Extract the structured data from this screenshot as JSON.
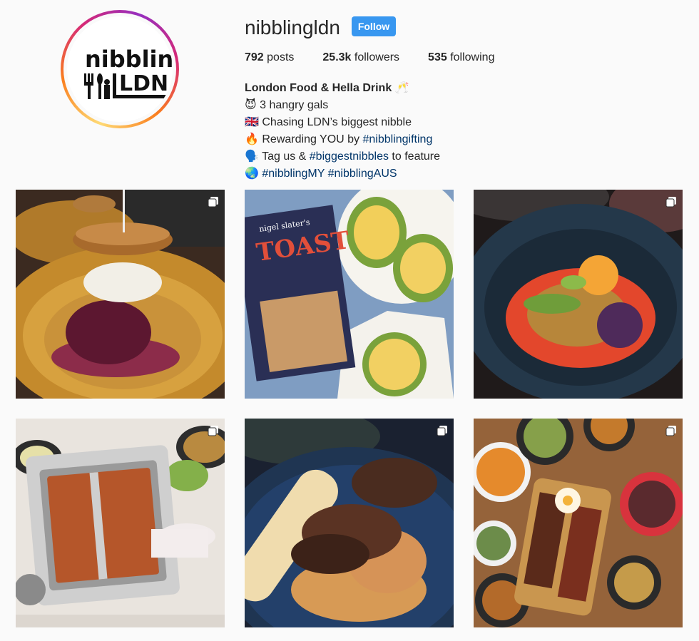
{
  "profile": {
    "username": "nibblingldn",
    "follow_label": "Follow",
    "logo": {
      "top": "nibbling",
      "bottom": "LDN"
    },
    "stats": {
      "posts_count": "792",
      "posts_label": "posts",
      "followers_count": "25.3k",
      "followers_label": "followers",
      "following_count": "535",
      "following_label": "following"
    },
    "bio": {
      "name": "London Food & Hella Drink",
      "name_emoji": "🥂",
      "lines": [
        {
          "emoji": "😈",
          "text": "3 hangry gals",
          "tag": ""
        },
        {
          "emoji": "🇬🇧",
          "text": "Chasing LDN’s biggest nibble",
          "tag": ""
        },
        {
          "emoji": "🔥",
          "text": "Rewarding YOU by ",
          "tag": "#nibblingifting"
        },
        {
          "emoji": "🗣️",
          "text": "Tag us & ",
          "tag": "#biggestnibbles",
          "after": " to feature"
        },
        {
          "emoji": "🌏",
          "text": "",
          "tag": "#nibblingMY #nibblingAUS"
        }
      ]
    }
  },
  "posts": [
    {
      "label": "Fried chicken burger stack on golden plate",
      "multi": true,
      "icon": "multiple-photos-icon"
    },
    {
      "label": "Avocado toast with Nigel Slater's TOAST flyer",
      "multi": false,
      "flyer_title": "TOAST",
      "flyer_sub": "nigel slater's"
    },
    {
      "label": "Dark bowl with red sauce and salad",
      "multi": true,
      "icon": "multiple-photos-icon"
    },
    {
      "label": "Hot pot with chopsticks",
      "multi": true,
      "icon": "multiple-photos-icon"
    },
    {
      "label": "Steak with sauce and roll on blue plate",
      "multi": true,
      "icon": "multiple-photos-icon"
    },
    {
      "label": "Thai spread with curries and platter",
      "multi": true,
      "icon": "multiple-photos-icon"
    }
  ],
  "colors": {
    "follow_bg": "#3897f0",
    "hashtag": "#003569",
    "background": "#fafafa"
  }
}
